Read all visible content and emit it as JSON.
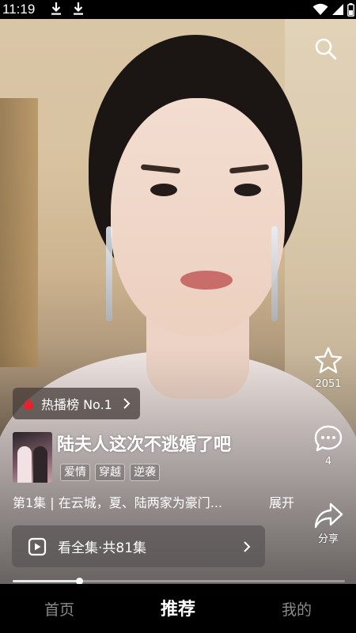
{
  "status_bar": {
    "time": "11:19"
  },
  "icons": {
    "download": "download-icon",
    "wifi": "wifi-icon",
    "signal": "signal-icon",
    "battery": "battery-icon",
    "search": "search-icon",
    "star": "star-icon",
    "comment": "comment-icon",
    "share": "share-icon",
    "fire": "fire-icon",
    "play": "play-icon",
    "chevron": "chevron-right-icon"
  },
  "side_actions": {
    "favorite_count": "2051",
    "comment_count": "4",
    "share_label": "分享"
  },
  "hot_badge": {
    "label": "热播榜 No.1"
  },
  "drama": {
    "title": "陆夫人这次不逃婚了吧",
    "tags": [
      "爱情",
      "穿越",
      "逆袭"
    ],
    "synopsis": "第1集 | 在云城，夏、陆两家为豪门...",
    "expand_label": "展开"
  },
  "watch_all": {
    "label": "看全集·共81集"
  },
  "progress": {
    "played_fraction": 0.2
  },
  "bottom_nav": {
    "items": [
      {
        "label": "首页",
        "active": false
      },
      {
        "label": "推荐",
        "active": true
      },
      {
        "label": "我的",
        "active": false
      }
    ]
  },
  "colors": {
    "nav_active": "#ffffff",
    "nav_inactive": "#8a8a8a",
    "fire_red": "#e8212e"
  }
}
